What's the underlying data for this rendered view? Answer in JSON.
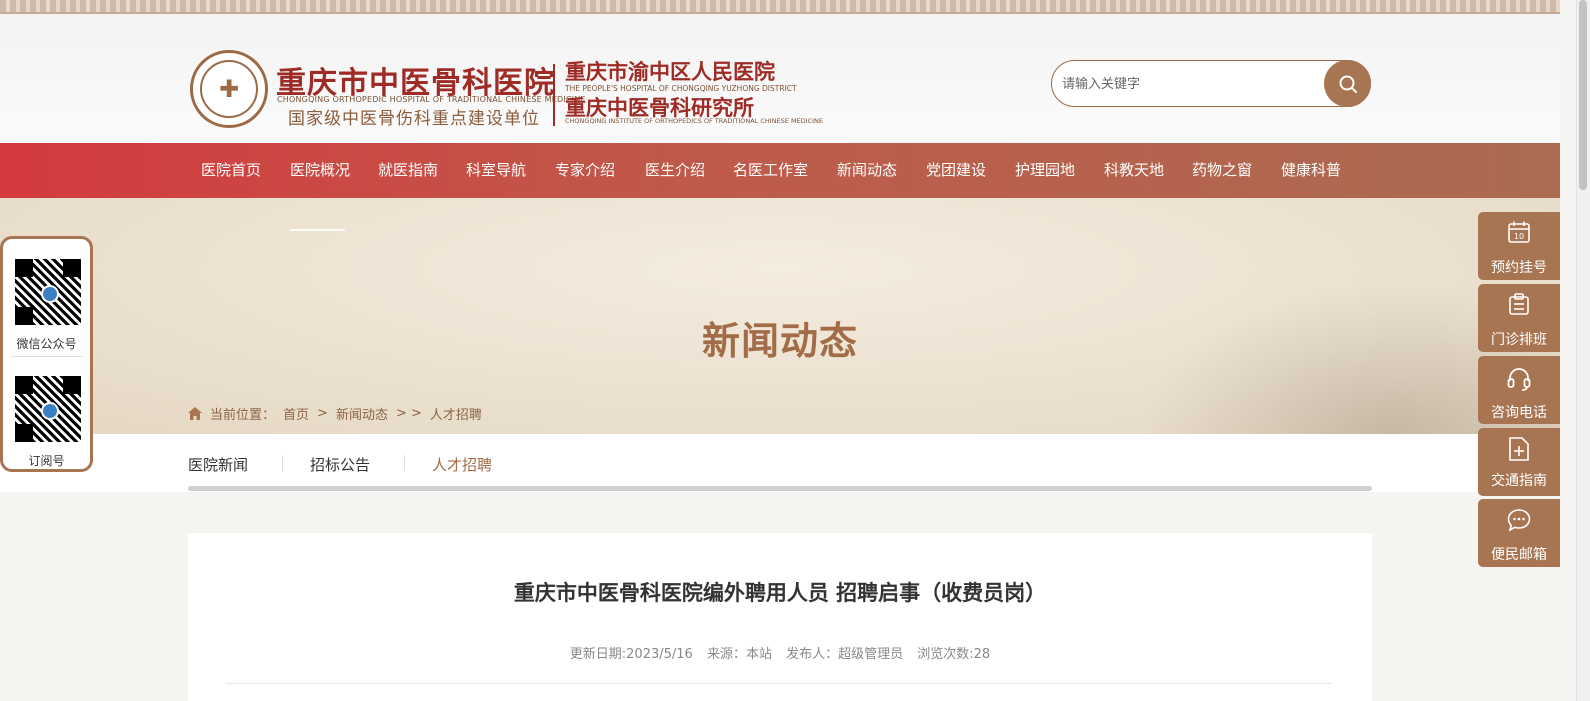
{
  "header": {
    "hospital_name": "重庆市中医骨科医院",
    "hospital_name_en": "CHONGQING ORTHOPEDIC HOSPITAL OF TRADITIONAL CHINESE MEDICINE",
    "subtitle": "国家级中医骨伤科重点建设单位",
    "affiliate_1": "重庆市渝中区人民医院",
    "affiliate_1_en": "THE PEOPLE'S HOSPITAL OF CHONGQING YUZHONG DISTRICT",
    "affiliate_2": "重庆中医骨科研究所",
    "affiliate_2_en": "CHONGQING INSTITUTE OF ORTHOPEDICS OF TRADITIONAL CHINESE MEDICINE",
    "search_placeholder": "请输入关键字"
  },
  "nav": {
    "items": [
      "医院首页",
      "医院概况",
      "就医指南",
      "科室导航",
      "专家介绍",
      "医生介绍",
      "名医工作室",
      "新闻动态",
      "党团建设",
      "护理园地",
      "科教天地",
      "药物之窗",
      "健康科普"
    ]
  },
  "banner": {
    "title": "新闻动态",
    "breadcrumb": {
      "prefix": "当前位置：",
      "home": "首页",
      "sep1": ">",
      "section": "新闻动态",
      "sep2": "> >",
      "current": "人才招聘"
    }
  },
  "sub_tabs": [
    "医院新闻",
    "招标公告",
    "人才招聘"
  ],
  "article": {
    "title": "重庆市中医骨科医院编外聘用人员 招聘启事（收费员岗）",
    "update_date": "更新日期:2023/5/16",
    "source": "来源：本站",
    "publisher": "发布人：超级管理员",
    "views": "浏览次数:28"
  },
  "qr": {
    "wechat_label": "微信公众号",
    "subscribe_label": "订阅号"
  },
  "side_buttons": [
    {
      "label": "预约挂号",
      "icon": "calendar-icon"
    },
    {
      "label": "门诊排班",
      "icon": "clipboard-icon"
    },
    {
      "label": "咨询电话",
      "icon": "headset-icon"
    },
    {
      "label": "交通指南",
      "icon": "map-plus-icon"
    },
    {
      "label": "便民邮箱",
      "icon": "chat-icon"
    }
  ],
  "colors": {
    "brand_brown": "#a87552",
    "brand_red": "#9e2b25",
    "nav_red": "#d43a3e"
  }
}
